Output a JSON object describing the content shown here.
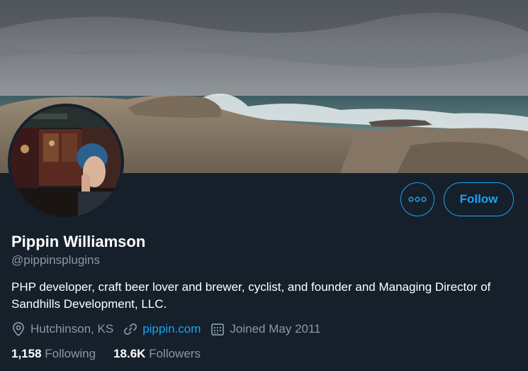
{
  "profile": {
    "name": "Pippin Williamson",
    "handle": "@pippinsplugins",
    "bio": "PHP developer, craft beer lover and brewer, cyclist, and founder and Managing Director of Sandhills Development, LLC.",
    "location": "Hutchinson, KS",
    "website": "pippin.com",
    "joined": "Joined May 2011"
  },
  "stats": {
    "following_count": "1,158",
    "following_label": "Following",
    "followers_count": "18.6K",
    "followers_label": "Followers"
  },
  "actions": {
    "follow_label": "Follow",
    "more_icon": "more-icon"
  },
  "icons": {
    "location": "location-pin-icon",
    "link": "link-icon",
    "calendar": "calendar-icon"
  },
  "colors": {
    "background": "#15202b",
    "accent": "#1da1f2",
    "secondary_text": "#8899a6"
  }
}
